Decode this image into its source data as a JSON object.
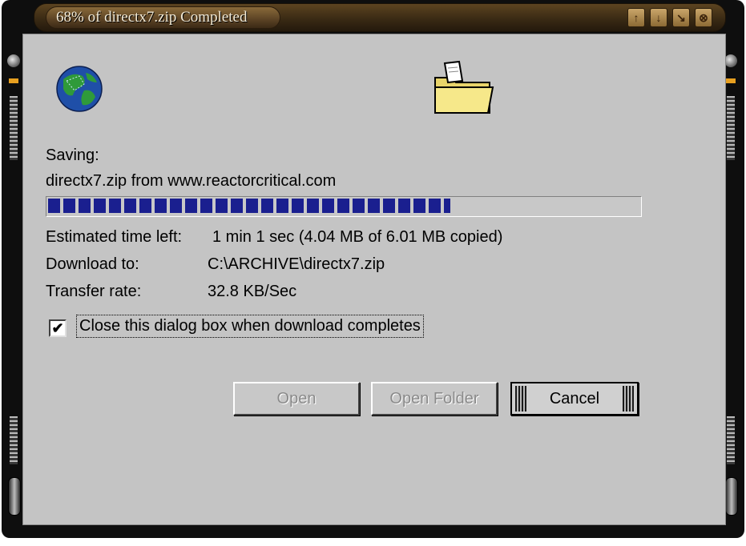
{
  "window": {
    "title": "68% of directx7.zip Completed",
    "title_buttons": [
      "↑",
      "↓",
      "↘",
      "⊗"
    ]
  },
  "dialog": {
    "saving_label": "Saving:",
    "file_source": "directx7.zip from www.reactorcritical.com",
    "progress_fraction": 0.68,
    "estimated_label": "Estimated time left:",
    "estimated_value": "1 min 1 sec (4.04 MB of 6.01 MB copied)",
    "download_to_label": "Download to:",
    "download_to_value": "C:\\ARCHIVE\\directx7.zip",
    "transfer_rate_label": "Transfer rate:",
    "transfer_rate_value": "32.8 KB/Sec",
    "close_when_done_label": "Close this dialog box when download completes",
    "close_when_done_checked": true
  },
  "buttons": {
    "open": "Open",
    "open_folder": "Open Folder",
    "cancel": "Cancel"
  },
  "icons": {
    "globe": "globe-icon",
    "folder": "folder-icon"
  },
  "colors": {
    "progress": "#1a1f8f",
    "panel": "#c4c4c4"
  }
}
